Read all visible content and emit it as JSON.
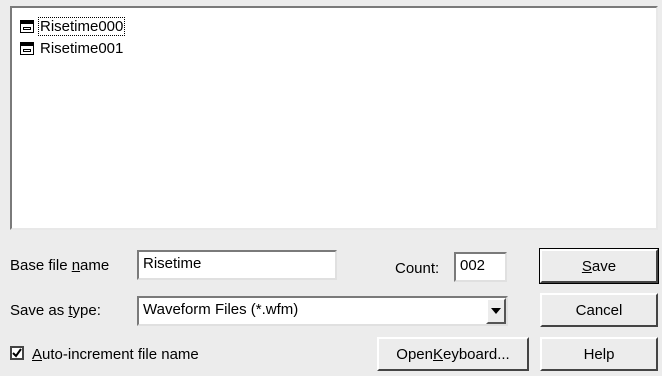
{
  "file_list": {
    "items": [
      {
        "name": "Risetime000"
      },
      {
        "name": "Risetime001"
      }
    ]
  },
  "base_file_name": {
    "label_pre": "Base file ",
    "label_underline": "n",
    "label_post": "ame",
    "value": "Risetime"
  },
  "count": {
    "label": "Count:",
    "value": "002"
  },
  "save_as_type": {
    "label_pre": "Save as ",
    "label_underline": "t",
    "label_post": "ype:",
    "value": "Waveform Files (*.wfm)"
  },
  "auto_increment": {
    "checked": true,
    "label_underline": "A",
    "label_post": "uto-increment file name"
  },
  "buttons": {
    "save_underline": "S",
    "save_post": "ave",
    "cancel": "Cancel",
    "help": "Help",
    "open_keyboard_pre": "Open ",
    "open_keyboard_underline": "K",
    "open_keyboard_post": "eyboard..."
  }
}
